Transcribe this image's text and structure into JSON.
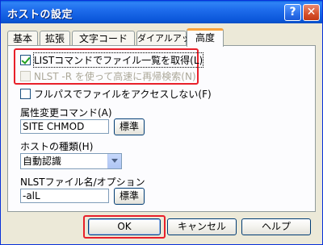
{
  "window": {
    "title": "ホストの設定"
  },
  "titlebar": {
    "help_glyph": "?",
    "close_glyph": "✕"
  },
  "tabs": [
    {
      "label": "基本"
    },
    {
      "label": "拡張"
    },
    {
      "label": "文字コード"
    },
    {
      "label": "ダイアルアップ"
    },
    {
      "label": "高度"
    }
  ],
  "active_tab": "高度",
  "options": {
    "list_command": {
      "label": "LISTコマンドでファイル一覧を取得(L)",
      "checked": true,
      "enabled": true
    },
    "nlst_r": {
      "label": "NLST -R を使って高速に再帰検索(N)",
      "checked": false,
      "enabled": false
    },
    "no_fullpath": {
      "label": "フルパスでファイルをアクセスしない(F)",
      "checked": false,
      "enabled": true
    }
  },
  "chmod": {
    "label": "属性変更コマンド(A)",
    "value": "SITE CHMOD",
    "default_button": "標準"
  },
  "host_type": {
    "label": "ホストの種類(H)",
    "selected": "自動認識"
  },
  "nlst": {
    "label": "NLSTファイル名/オプション",
    "value": "-alL",
    "default_button": "標準"
  },
  "buttons": {
    "ok": "OK",
    "cancel": "キャンセル",
    "help": "ヘルプ"
  },
  "colors": {
    "titlebar": "#0B57DA",
    "face": "#ECE9D8",
    "highlight": "#E8202A",
    "active_tab_accent": "#F7A23B"
  }
}
